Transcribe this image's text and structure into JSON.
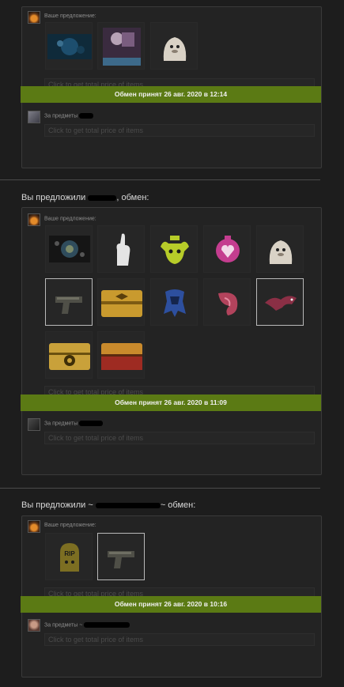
{
  "trades": [
    {
      "heading": "",
      "your_offer_label": "Ваше предложение:",
      "their_items_label": "За предметы",
      "price_prompt_top": "Click to get total price of items",
      "status": "Обмен принят 26 авг. 2020 в 12:14",
      "price_prompt_bottom": "Click to get total price of items",
      "items": [
        "music-kit-sticker",
        "graffiti-card",
        "seal-sticker"
      ]
    },
    {
      "heading": "Вы предложили",
      "heading_suffix": ", обмен:",
      "your_offer_label": "Ваше предложение:",
      "their_items_label": "За предметы",
      "price_prompt_top": "Click to get total price of items",
      "status": "Обмен принят 26 авг. 2020 в 11:09",
      "price_prompt_bottom": "Click to get total price of items",
      "items": [
        "music-kit",
        "hand-sticker",
        "666-bull-sticker",
        "heart-patch",
        "seal-sticker",
        "pistol",
        "weapon-case",
        "blue-patch",
        "tongue-sticker",
        "dragon-sticker",
        "yellow-case",
        "red-case"
      ]
    },
    {
      "heading": "Вы предложили ~",
      "heading_suffix": "~ обмен:",
      "your_offer_label": "Ваше предложение:",
      "their_items_label": "За предметы ~",
      "price_prompt_top": "Click to get total price of items",
      "status": "Обмен принят 26 авг. 2020 в 10:16",
      "price_prompt_bottom": "Click to get total price of items",
      "items": [
        "rip-sticker",
        "pistol"
      ]
    }
  ],
  "colors": {
    "status_green": "#5b7a14",
    "background": "#1d1d1d",
    "card": "#232323"
  }
}
